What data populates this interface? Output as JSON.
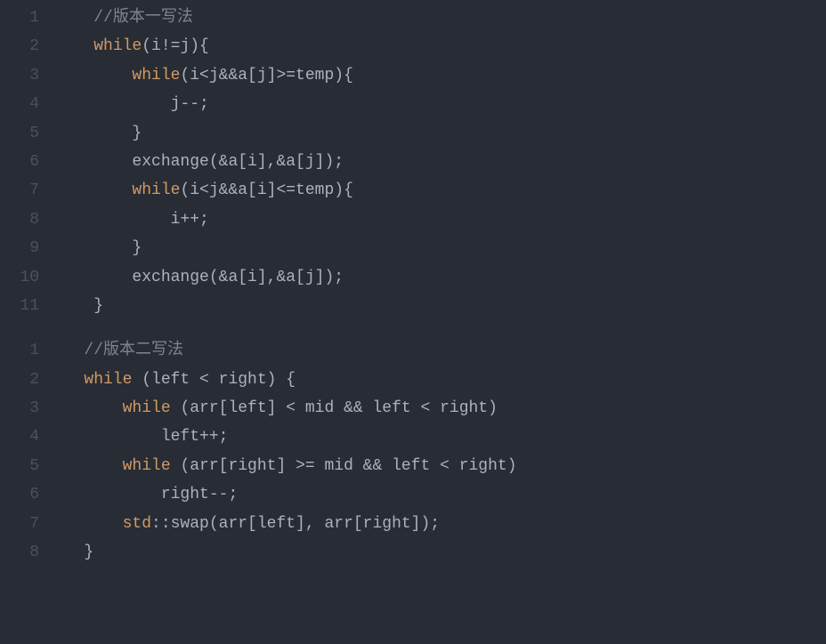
{
  "blocks": [
    {
      "lines": [
        {
          "n": "1",
          "indent": "    ",
          "tokens": [
            {
              "t": "//版本一写法",
              "c": "tok-comment"
            }
          ]
        },
        {
          "n": "2",
          "indent": "    ",
          "tokens": [
            {
              "t": "while",
              "c": "tok-keyword"
            },
            {
              "t": "(i!=j){",
              "c": "tok-punct"
            }
          ]
        },
        {
          "n": "3",
          "indent": "        ",
          "tokens": [
            {
              "t": "while",
              "c": "tok-keyword"
            },
            {
              "t": "(i<j&&a[j]>=temp){",
              "c": "tok-punct"
            }
          ]
        },
        {
          "n": "4",
          "indent": "            ",
          "tokens": [
            {
              "t": "j--;",
              "c": "tok-punct"
            }
          ]
        },
        {
          "n": "5",
          "indent": "        ",
          "tokens": [
            {
              "t": "}",
              "c": "tok-punct"
            }
          ]
        },
        {
          "n": "6",
          "indent": "        ",
          "tokens": [
            {
              "t": "exchange(&a[i],&a[j]);",
              "c": "tok-func"
            }
          ]
        },
        {
          "n": "7",
          "indent": "        ",
          "tokens": [
            {
              "t": "while",
              "c": "tok-keyword"
            },
            {
              "t": "(i<j&&a[i]<=temp){",
              "c": "tok-punct"
            }
          ]
        },
        {
          "n": "8",
          "indent": "            ",
          "tokens": [
            {
              "t": "i++;",
              "c": "tok-punct"
            }
          ]
        },
        {
          "n": "9",
          "indent": "        ",
          "tokens": [
            {
              "t": "}",
              "c": "tok-punct"
            }
          ]
        },
        {
          "n": "10",
          "indent": "        ",
          "tokens": [
            {
              "t": "exchange(&a[i],&a[j]);",
              "c": "tok-func"
            }
          ]
        },
        {
          "n": "11",
          "indent": "    ",
          "tokens": [
            {
              "t": "}",
              "c": "tok-punct"
            }
          ]
        }
      ]
    },
    {
      "lines": [
        {
          "n": "1",
          "indent": "   ",
          "tokens": [
            {
              "t": "//版本二写法",
              "c": "tok-comment"
            }
          ]
        },
        {
          "n": "2",
          "indent": "   ",
          "tokens": [
            {
              "t": "while",
              "c": "tok-keyword"
            },
            {
              "t": " (left < right) {",
              "c": "tok-punct"
            }
          ]
        },
        {
          "n": "3",
          "indent": "       ",
          "tokens": [
            {
              "t": "while",
              "c": "tok-keyword"
            },
            {
              "t": " (arr[left] < mid && left < right)",
              "c": "tok-punct"
            }
          ]
        },
        {
          "n": "4",
          "indent": "           ",
          "tokens": [
            {
              "t": "left++;",
              "c": "tok-punct"
            }
          ]
        },
        {
          "n": "5",
          "indent": "       ",
          "tokens": [
            {
              "t": "while",
              "c": "tok-keyword"
            },
            {
              "t": " (arr[right] >= mid && left < right)",
              "c": "tok-punct"
            }
          ]
        },
        {
          "n": "6",
          "indent": "           ",
          "tokens": [
            {
              "t": "right--;",
              "c": "tok-punct"
            }
          ]
        },
        {
          "n": "7",
          "indent": "       ",
          "tokens": [
            {
              "t": "std",
              "c": "tok-keyword"
            },
            {
              "t": "::swap(arr[left], arr[right]);",
              "c": "tok-punct"
            }
          ]
        },
        {
          "n": "8",
          "indent": "   ",
          "tokens": [
            {
              "t": "}",
              "c": "tok-punct"
            }
          ]
        }
      ]
    }
  ]
}
